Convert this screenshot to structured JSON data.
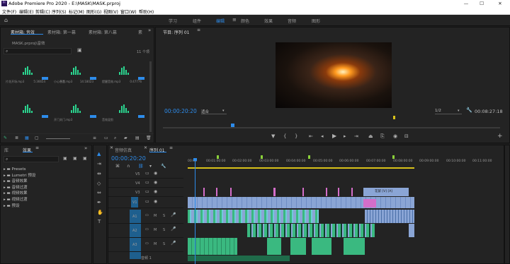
{
  "window": {
    "title": "Adobe Premiere Pro 2020 - E:\\MASK\\MASK.prproj",
    "app_icon": "Pr",
    "minimize": "—",
    "maximize": "☐",
    "close": "✕"
  },
  "menu": [
    "文件(F)",
    "编辑(E)",
    "剪辑(C)",
    "序列(S)",
    "标记(M)",
    "图形(G)",
    "视图(V)",
    "窗口(W)",
    "帮助(H)"
  ],
  "workspaces": [
    "学习",
    "组件",
    "编辑",
    "颜色",
    "效果",
    "音频",
    "图形"
  ],
  "active_workspace": "编辑",
  "project_panel": {
    "tabs": [
      "素材箱: 音效",
      "素材箱: 第一幕",
      "素材箱: 第八幕",
      "素"
    ],
    "path": "MASK.prproj\\音效",
    "count": "11 个项",
    "items": [
      {
        "name": "片花开场.mp3",
        "dur": "5:36654"
      },
      {
        "name": "小心愚蠢.mp3",
        "dur": "14:18023"
      },
      {
        "name": "提醒音效.mp3",
        "dur": "0:47776"
      },
      {
        "name": "",
        "dur": ""
      },
      {
        "name": "开门关门.mp3",
        "dur": ""
      },
      {
        "name": "音效混剪",
        "dur": ""
      }
    ]
  },
  "program_monitor": {
    "title": "节目: 序列 01",
    "timecode": "00:00:20:20",
    "fit": "适合",
    "quality": "1/2",
    "duration": "00:08:27:18"
  },
  "effects_panel": {
    "tabs": [
      "库",
      "效果"
    ],
    "items": [
      "Presets",
      "Lumetri 预设",
      "音频效果",
      "音频过渡",
      "视频效果",
      "视频过渡",
      "预设"
    ]
  },
  "timeline": {
    "tabs": [
      "音频仿真",
      "序列 01"
    ],
    "timecode": "00:00:20:20",
    "ruler": [
      "00:00",
      "00:01:00:00",
      "00:02:00:00",
      "00:03:00:00",
      "00:04:00:00",
      "00:05:00:00",
      "00:06:00:00",
      "00:07:00:00",
      "00:08:00:00",
      "00:09:00:00",
      "00:10:00:00",
      "00:11:00:00"
    ],
    "video_tracks": [
      "V5",
      "V4",
      "V3",
      "V2",
      "V1"
    ],
    "audio_tracks": [
      "A1",
      "A2",
      "A3",
      "A4"
    ],
    "track_buttons": {
      "mute": "M",
      "solo": "S"
    },
    "master_label": "音频 1",
    "clip_label": "花絮 [V] [A]"
  },
  "colors": {
    "accent": "#2d8ceb",
    "audio_clip": "#3ab980",
    "video_clip": "#8aa5d5",
    "nest_clip": "#d46ec9"
  }
}
